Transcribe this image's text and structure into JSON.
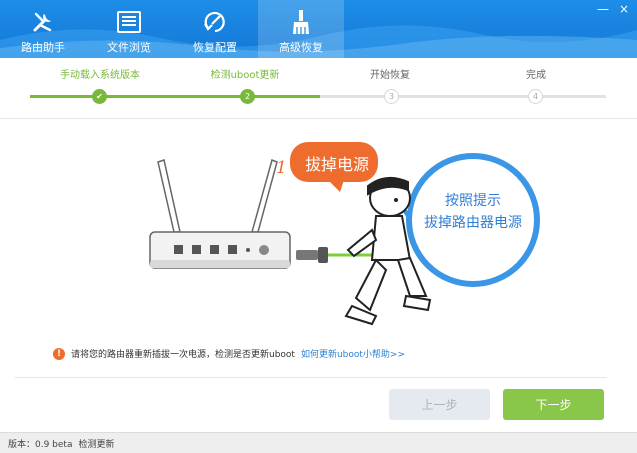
{
  "nav": {
    "items": [
      {
        "label": "路由助手",
        "icon": "wrench-screwdriver-icon"
      },
      {
        "label": "文件浏览",
        "icon": "file-list-icon"
      },
      {
        "label": "恢复配置",
        "icon": "restore-icon"
      },
      {
        "label": "高级恢复",
        "icon": "brush-icon",
        "active": true
      }
    ]
  },
  "window": {
    "minimize": "—",
    "close": "×"
  },
  "steps": [
    {
      "label": "手动载入系统版本",
      "number": "✔",
      "state": "done"
    },
    {
      "label": "检测uboot更新",
      "number": "2",
      "state": "current"
    },
    {
      "label": "开始恢复",
      "number": "3",
      "state": "todo"
    },
    {
      "label": "完成",
      "number": "4",
      "state": "todo"
    }
  ],
  "illustration": {
    "step_number": "1",
    "bubble_text": "拔掉电源",
    "circle_line1": "按照提示",
    "circle_line2": "拔掉路由器电源"
  },
  "notice": {
    "icon": "warning-icon",
    "text": "请将您的路由器重新插拔一次电源，检测是否更新uboot",
    "link": "如何更新uboot小帮助>>"
  },
  "buttons": {
    "prev": "上一步",
    "next": "下一步"
  },
  "status": {
    "version": "版本：0.9 beta",
    "check": "检测更新"
  },
  "colors": {
    "header": "#1883e0",
    "accent_green": "#79b83a",
    "orange": "#ef6c2f",
    "circle_blue": "#3b97e6"
  }
}
